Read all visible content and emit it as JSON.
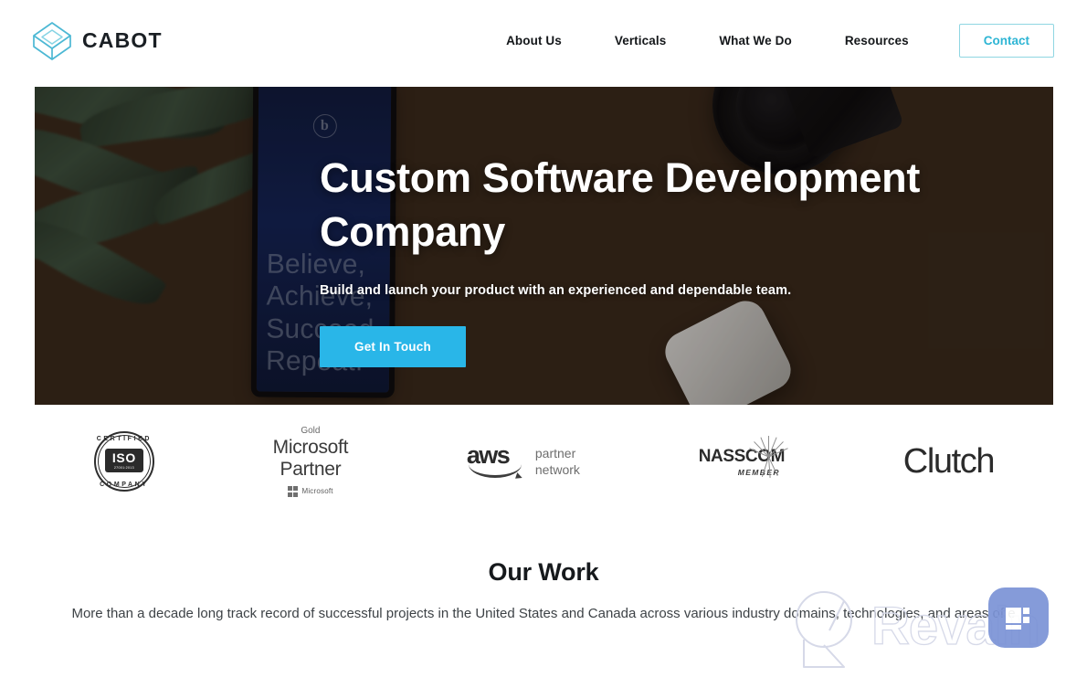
{
  "header": {
    "brand_name": "CABOT",
    "logo_icon": "cabot-cube-icon",
    "nav_items": [
      {
        "label": "About Us"
      },
      {
        "label": "Verticals"
      },
      {
        "label": "What We Do"
      },
      {
        "label": "Resources"
      }
    ],
    "contact_label": "Contact",
    "accent_color": "#2eb5d4",
    "contact_border_color": "#8fd6e2"
  },
  "hero": {
    "title": "Custom Software Development Company",
    "subtitle": "Build and launch your product with an experienced and dependable team.",
    "cta_label": "Get In Touch",
    "cta_color": "#29b6e8",
    "phone_logo_glyph": "b",
    "phone_words": "Believe, Achieve, Succeed, Repeat."
  },
  "partners": {
    "iso": {
      "arc_top": "CERTIFIED",
      "core": "ISO",
      "core_sub": "27001:2013",
      "arc_bottom": "COMPANY"
    },
    "microsoft": {
      "tier": "Gold",
      "line1": "Microsoft",
      "line2": "Partner",
      "footer": "Microsoft"
    },
    "aws": {
      "mark": "aws",
      "line1": "partner",
      "line2": "network"
    },
    "nasscom": {
      "name": "NASSCOM",
      "status": "MEMBER"
    },
    "clutch": {
      "name": "Clutch"
    }
  },
  "our_work": {
    "title": "Our Work",
    "description": "More than a decade long track record of successful projects in the United States and Canada across various industry domains, technologies, and areas of e"
  },
  "watermark": {
    "text": "Revain",
    "icon": "magnifier-q-icon"
  },
  "chat_widget": {
    "icon": "chat-widget-icon",
    "color": "#7b93d6"
  }
}
